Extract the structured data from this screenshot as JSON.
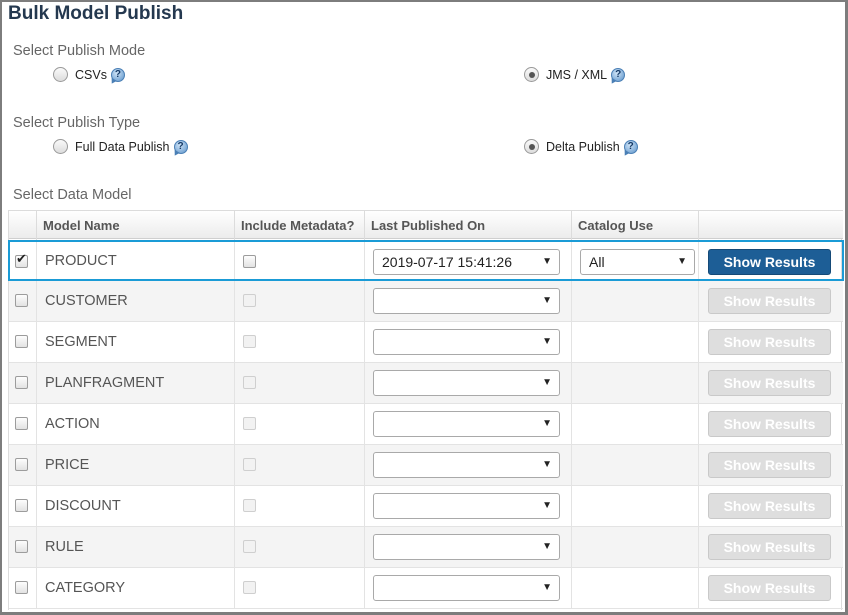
{
  "page": {
    "title": "Bulk Model Publish"
  },
  "publish_mode": {
    "label": "Select Publish Mode",
    "options": [
      {
        "label": "CSVs",
        "checked": false
      },
      {
        "label": "JMS / XML",
        "checked": true
      }
    ]
  },
  "publish_type": {
    "label": "Select Publish Type",
    "options": [
      {
        "label": "Full Data Publish",
        "checked": false
      },
      {
        "label": "Delta Publish",
        "checked": true
      }
    ]
  },
  "data_model": {
    "label": "Select Data Model",
    "columns": [
      "Model Name",
      "Include Metadata?",
      "Last Published On",
      "Catalog Use"
    ],
    "button_label": "Show Results",
    "rows": [
      {
        "name": "PRODUCT",
        "selected": true,
        "last_published": "2019-07-17 15:41:26",
        "catalog_use": "All"
      },
      {
        "name": "CUSTOMER",
        "selected": false,
        "last_published": "",
        "catalog_use": ""
      },
      {
        "name": "SEGMENT",
        "selected": false,
        "last_published": "",
        "catalog_use": ""
      },
      {
        "name": "PLANFRAGMENT",
        "selected": false,
        "last_published": "",
        "catalog_use": ""
      },
      {
        "name": "ACTION",
        "selected": false,
        "last_published": "",
        "catalog_use": ""
      },
      {
        "name": "PRICE",
        "selected": false,
        "last_published": "",
        "catalog_use": ""
      },
      {
        "name": "DISCOUNT",
        "selected": false,
        "last_published": "",
        "catalog_use": ""
      },
      {
        "name": "RULE",
        "selected": false,
        "last_published": "",
        "catalog_use": ""
      },
      {
        "name": "CATEGORY",
        "selected": false,
        "last_published": "",
        "catalog_use": ""
      }
    ]
  },
  "colors": {
    "accent": "#1d5e96",
    "selection_border": "#1a9bd6",
    "title": "#24384f"
  }
}
